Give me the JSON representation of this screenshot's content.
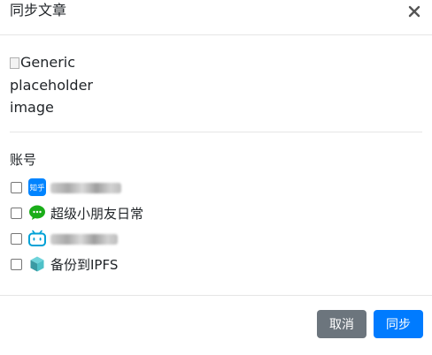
{
  "dialog": {
    "title": "同步文章",
    "close_icon": "close-icon"
  },
  "image": {
    "alt_text": "Generic placeholder image"
  },
  "accounts_section": {
    "label": "账号",
    "accounts": [
      {
        "platform": "知乎",
        "icon": "zhihu-icon",
        "name": "超级小朋友",
        "name_blurred": true,
        "checked": false,
        "brand_color": "#0084ff"
      },
      {
        "platform": "WeChat",
        "icon": "wechat-icon",
        "name": "超级小朋友日常",
        "name_blurred": false,
        "checked": false,
        "brand_color": "#1aad19"
      },
      {
        "platform": "Bilibili",
        "icon": "bilibili-icon",
        "name": "",
        "name_blurred": true,
        "checked": false,
        "brand_color": "#00a1d6"
      },
      {
        "platform": "IPFS",
        "icon": "ipfs-cube-icon",
        "name": "备份到IPFS",
        "name_blurred": false,
        "checked": false,
        "brand_color": "#4ec1c8"
      }
    ]
  },
  "footer": {
    "cancel_label": "取消",
    "sync_label": "同步"
  },
  "colors": {
    "primary": "#007bff",
    "secondary": "#6c757d",
    "divider": "#e6e6e6"
  }
}
